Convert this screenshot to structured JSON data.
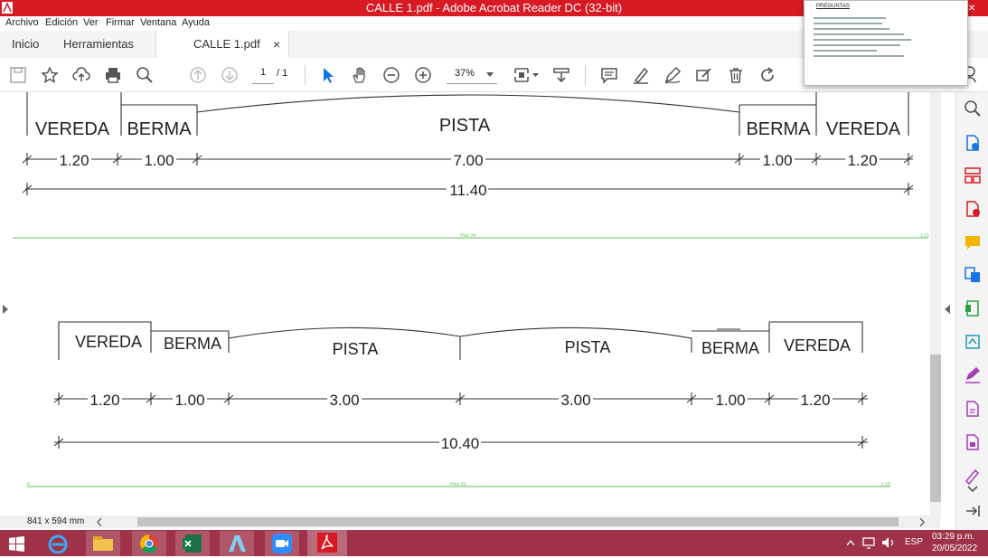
{
  "window": {
    "title": "CALLE 1.pdf - Adobe Acrobat Reader DC (32-bit)",
    "close_glyph": "×"
  },
  "menu": [
    "Archivo",
    "Edición",
    "Ver",
    "Firmar",
    "Ventana",
    "Ayuda"
  ],
  "tabs": {
    "home": "Inicio",
    "tools": "Herramientas",
    "document": "CALLE 1.pdf",
    "close": "×"
  },
  "toolbar": {
    "page_current": "1",
    "page_total": "/ 1",
    "zoom": "37%"
  },
  "preview": {
    "heading": "PREGUNTAS"
  },
  "section1": {
    "labels": [
      "VEREDA",
      "BERMA",
      "PISTA",
      "BERMA",
      "VEREDA"
    ],
    "dims": [
      "1.20",
      "1.00",
      "7.00",
      "1.00",
      "1.20"
    ],
    "total": "11.40",
    "floor_label": "Piso (4)",
    "scale": "1:15"
  },
  "section2": {
    "labels": [
      "VEREDA",
      "BERMA",
      "PISTA",
      "PISTA",
      "BERMA",
      "VEREDA"
    ],
    "dims": [
      "1.20",
      "1.00",
      "3.00",
      "3.00",
      "1.00",
      "1.20"
    ],
    "total": "10.40",
    "floor_label": "Piso (5)",
    "scale": "1:15",
    "left_mark": "0."
  },
  "status": {
    "page_size": "841 x 594 mm"
  },
  "taskbar": {
    "language": "ESP",
    "time": "03:29 p.m.",
    "date": "20/05/2022"
  },
  "colors": {
    "titlebar": "#d71a24",
    "taskbar": "#9e3248",
    "green_line": "#5fc25a",
    "acrobat_blue": "#1473e6"
  }
}
